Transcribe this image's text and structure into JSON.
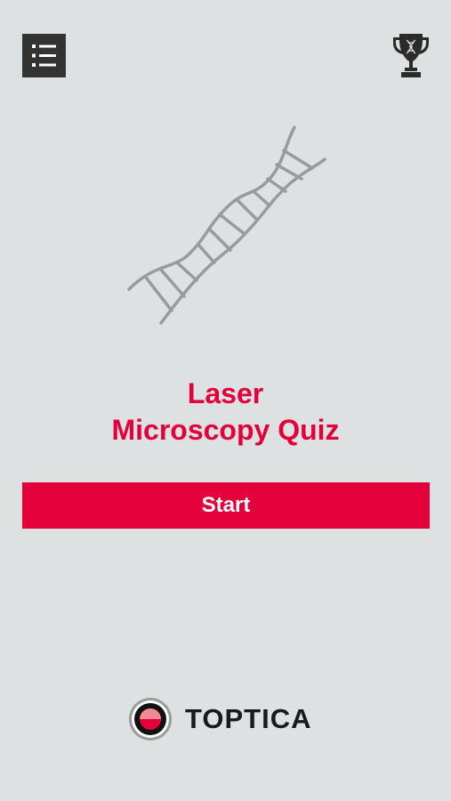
{
  "header": {
    "menu_icon": "list-menu-icon",
    "trophy_icon": "trophy-icon"
  },
  "hero": {
    "illustration": "dna-helix-icon"
  },
  "title": {
    "line1": "Laser",
    "line2": "Microscopy Quiz"
  },
  "actions": {
    "start_label": "Start"
  },
  "brand": {
    "name": "TOPTICA"
  },
  "colors": {
    "background": "#dee1e2",
    "accent": "#e4003a",
    "dark": "#333333",
    "dna": "#9a9a9a"
  }
}
